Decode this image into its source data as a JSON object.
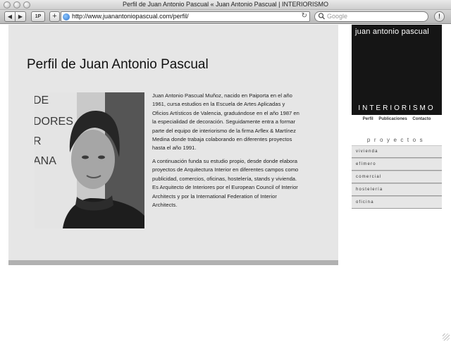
{
  "window": {
    "title": "Perfil de Juan Antonio Pascual « Juan Antonio Pascual | INTERIORISMO"
  },
  "toolbar": {
    "back_label": "◀",
    "forward_label": "▶",
    "onepass_label": "1P",
    "add_label": "+",
    "url": "http://www.juanantoniopascual.com/perfil/",
    "reload_icon": "↻",
    "search_placeholder": "Google",
    "search_icon": "🔍",
    "stop_label": "!"
  },
  "page": {
    "title": "Perfil de Juan Antonio Pascual",
    "bio": [
      "Juan Antonio Pascual Muñoz, nacido en Paiporta en el año 1961, cursa estudios en la Escuela de Artes Aplicadas y Oficios Artísticos de Valencia, graduándose en el año 1987 en la especialidad de decoración. Seguidamente entra a formar parte del equipo de interiorismo de la firma Arflex & Martínez Medina donde trabaja colaborando en diferentes proyectos hasta el año 1991.",
      "A continuación funda su estudio propio, desde donde elabora proyectos de Arquitectura Interior en diferentes campos como publicidad, comercios, oficinas, hostelería, stands y vivienda. Es Arquitecto de Interiores por el European Council of Interior Architects y por la International Federation of Interior Architects."
    ]
  },
  "sidebar": {
    "logo_line1": "juan antonio pascual",
    "logo_line2": "INTERIORISMO",
    "nav": [
      "Perfil",
      "Publicaciones",
      "Contacto"
    ],
    "projects_label": "proyectos",
    "projects": [
      "vivienda",
      "efímero",
      "comercial",
      "hostelería",
      "oficina"
    ]
  },
  "colors": {
    "logo_bg": "#151515",
    "content_bg": "#e6e6e6",
    "content_border": "#b1b1b1"
  }
}
